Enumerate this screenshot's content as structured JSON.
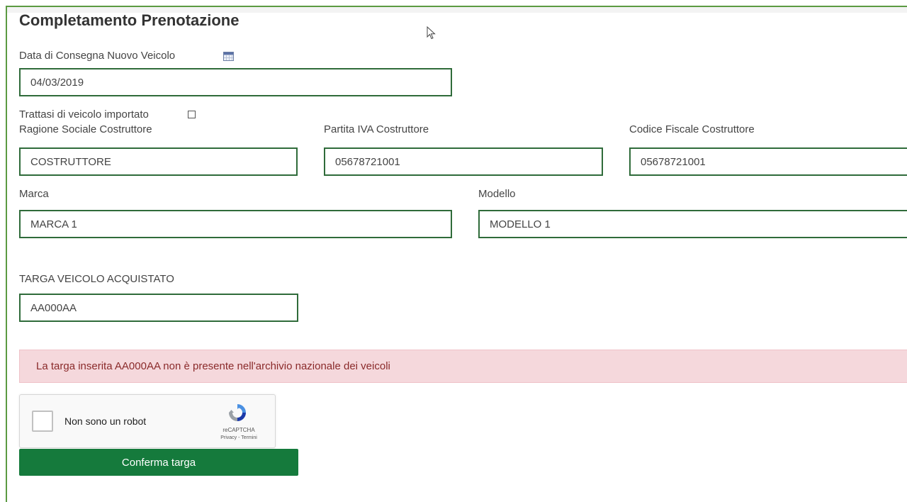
{
  "title": "Completamento Prenotazione",
  "delivery_date": {
    "label": "Data di Consegna Nuovo Veicolo",
    "value": "04/03/2019",
    "icon": "calendar-icon"
  },
  "imported_vehicle": {
    "label": "Trattasi di veicolo importato",
    "checked": false
  },
  "manufacturer": {
    "name_label": "Ragione Sociale Costruttore",
    "name_value": "COSTRUTTORE",
    "vat_label": "Partita IVA Costruttore",
    "vat_value": "05678721001",
    "tax_code_label": "Codice Fiscale Costruttore",
    "tax_code_value": "05678721001"
  },
  "vehicle": {
    "brand_label": "Marca",
    "brand_value": "MARCA 1",
    "model_label": "Modello",
    "model_value": "MODELLO 1"
  },
  "plate": {
    "label": "TARGA VEICOLO ACQUISTATO",
    "value": "AA000AA"
  },
  "alert": {
    "message": "La targa inserita AA000AA non è presente nell'archivio nazionale dei veicoli",
    "bg_color": "#f5d8dc"
  },
  "captcha": {
    "label": "Non sono un robot",
    "brand": "reCAPTCHA",
    "links": "Privacy - Termini"
  },
  "confirm_button": {
    "label": "Conferma targa",
    "color": "#157a3c"
  },
  "colors": {
    "field_border": "#2f6b3a",
    "frame_border": "#5b9a42"
  }
}
